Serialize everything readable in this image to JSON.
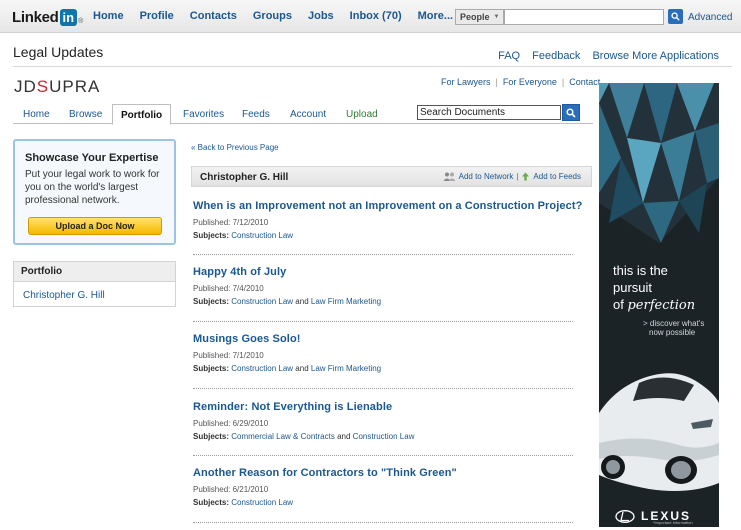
{
  "topbar": {
    "logo_text": "Linked",
    "logo_in": "in",
    "logo_reg": "®",
    "nav": [
      "Home",
      "Profile",
      "Contacts",
      "Groups",
      "Jobs",
      "Inbox (70)",
      "More..."
    ],
    "search_scope": "People",
    "advanced_label": "Advanced"
  },
  "app": {
    "title": "Legal Updates",
    "links": [
      "FAQ",
      "Feedback",
      "Browse More Applications"
    ]
  },
  "jdsupra": {
    "logo_a": "JD",
    "logo_s": "S",
    "logo_b": "UPRA",
    "sub_links": [
      "For Lawyers",
      "For Everyone",
      "Contact"
    ],
    "tabs": [
      "Home",
      "Browse",
      "Portfolio",
      "Favorites",
      "Feeds",
      "Account",
      "Upload"
    ],
    "active_tab": "Portfolio",
    "search_value": "Search Documents"
  },
  "sidebar": {
    "showcase_title": "Showcase Your Expertise",
    "showcase_text": "Put your legal work to work for you on the world's largest professional network.",
    "upload_label": "Upload a Doc Now",
    "portfolio_heading": "Portfolio",
    "portfolio_item": "Christopher G. Hill"
  },
  "main": {
    "back_link": "« Back to Previous Page",
    "author": "Christopher G. Hill",
    "add_network": "Add to Network",
    "add_feeds": "Add to Feeds",
    "published_label": "Published:",
    "subjects_label": "Subjects:",
    "and_word": "and",
    "articles": [
      {
        "title": "When is an Improvement not an Improvement on a Construction Project?",
        "date": "7/12/2010",
        "subjects": [
          "Construction Law"
        ]
      },
      {
        "title": "Happy 4th of July",
        "date": "7/4/2010",
        "subjects": [
          "Construction Law",
          "Law Firm Marketing"
        ]
      },
      {
        "title": "Musings Goes Solo!",
        "date": "7/1/2010",
        "subjects": [
          "Construction Law",
          "Law Firm Marketing"
        ]
      },
      {
        "title": "Reminder: Not Everything is Lienable",
        "date": "6/29/2010",
        "subjects": [
          "Commercial Law & Contracts",
          "Construction Law"
        ]
      },
      {
        "title": "Another Reason for Contractors to \"Think Green\"",
        "date": "6/21/2010",
        "subjects": [
          "Construction Law"
        ]
      }
    ]
  },
  "ad": {
    "line1": "this is the",
    "line2": "pursuit",
    "line3_prefix": "of ",
    "line3_italic": "perfection",
    "cta1": "> discover what's",
    "cta2": "now possible",
    "brand": "LEXUS",
    "fine": "*Important Information"
  }
}
